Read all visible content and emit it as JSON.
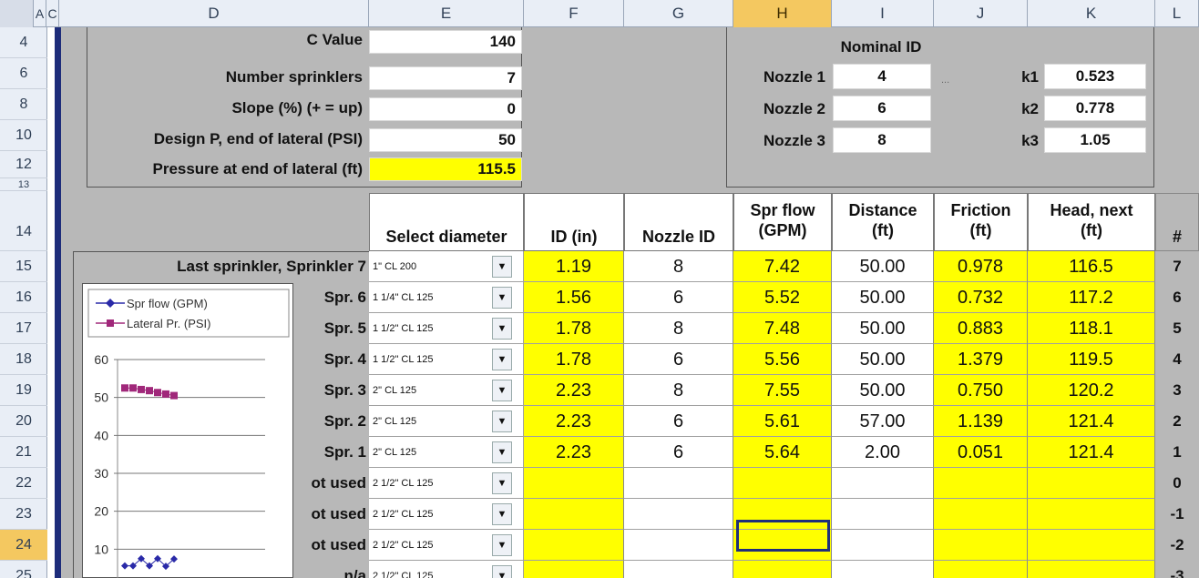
{
  "columns": [
    "A",
    "C",
    "D",
    "E",
    "F",
    "G",
    "H",
    "I",
    "J",
    "K",
    "L"
  ],
  "rows": [
    "4",
    "6",
    "8",
    "10",
    "12",
    "13",
    "14",
    "15",
    "16",
    "17",
    "18",
    "19",
    "20",
    "21",
    "22",
    "23",
    "24",
    "25"
  ],
  "inputs_panel": {
    "c_value_label": "C Value",
    "c_value": "140",
    "num_sprinklers_label": "Number sprinklers",
    "num_sprinklers": "7",
    "slope_label": "Slope (%) (+ = up)",
    "slope": "0",
    "design_p_label": "Design P, end of lateral (PSI)",
    "design_p": "50",
    "pressure_end_label": "Pressure at end of lateral (ft)",
    "pressure_end": "115.5"
  },
  "nozzle_panel": {
    "title": "Nominal ID",
    "nozzles": [
      {
        "label": "Nozzle 1",
        "id": "4",
        "k_label": "k1",
        "k": "0.523"
      },
      {
        "label": "Nozzle 2",
        "id": "6",
        "k_label": "k2",
        "k": "0.778"
      },
      {
        "label": "Nozzle 3",
        "id": "8",
        "k_label": "k3",
        "k": "1.05"
      }
    ],
    "ellipsis": "..."
  },
  "table": {
    "headers": {
      "select_diameter": "Select diameter",
      "id_in": "ID (in)",
      "nozzle_id": "Nozzle ID",
      "spr_flow_1": "Spr flow",
      "spr_flow_2": "(GPM)",
      "distance_1": "Distance",
      "distance_2": "(ft)",
      "friction_1": "Friction",
      "friction_2": "(ft)",
      "head_1": "Head, next",
      "head_2": "(ft)",
      "num": "#"
    },
    "rows": [
      {
        "label": "Last sprinkler, Sprinkler 7",
        "diameter": "1\" CL 200",
        "id_in": "1.19",
        "nozzle": "8",
        "flow": "7.42",
        "distance": "50.00",
        "friction": "0.978",
        "head": "116.5",
        "num": "7"
      },
      {
        "label": "Spr. 6",
        "diameter": "1 1/4\" CL 125",
        "id_in": "1.56",
        "nozzle": "6",
        "flow": "5.52",
        "distance": "50.00",
        "friction": "0.732",
        "head": "117.2",
        "num": "6"
      },
      {
        "label": "Spr. 5",
        "diameter": "1 1/2\" CL 125",
        "id_in": "1.78",
        "nozzle": "8",
        "flow": "7.48",
        "distance": "50.00",
        "friction": "0.883",
        "head": "118.1",
        "num": "5"
      },
      {
        "label": "Spr. 4",
        "diameter": "1 1/2\" CL 125",
        "id_in": "1.78",
        "nozzle": "6",
        "flow": "5.56",
        "distance": "50.00",
        "friction": "1.379",
        "head": "119.5",
        "num": "4"
      },
      {
        "label": "Spr. 3",
        "diameter": "2\" CL 125",
        "id_in": "2.23",
        "nozzle": "8",
        "flow": "7.55",
        "distance": "50.00",
        "friction": "0.750",
        "head": "120.2",
        "num": "3"
      },
      {
        "label": "Spr. 2",
        "diameter": "2\" CL 125",
        "id_in": "2.23",
        "nozzle": "6",
        "flow": "5.61",
        "distance": "57.00",
        "friction": "1.139",
        "head": "121.4",
        "num": "2"
      },
      {
        "label": "Spr. 1",
        "diameter": "2\" CL 125",
        "id_in": "2.23",
        "nozzle": "6",
        "flow": "5.64",
        "distance": "2.00",
        "friction": "0.051",
        "head": "121.4",
        "num": "1"
      },
      {
        "label": "ot used",
        "diameter": "2 1/2\" CL 125",
        "id_in": "",
        "nozzle": "",
        "flow": "",
        "distance": "",
        "friction": "",
        "head": "",
        "num": "0"
      },
      {
        "label": "ot used",
        "diameter": "2 1/2\" CL 125",
        "id_in": "",
        "nozzle": "",
        "flow": "",
        "distance": "",
        "friction": "",
        "head": "",
        "num": "-1"
      },
      {
        "label": "ot used",
        "diameter": "2 1/2\" CL 125",
        "id_in": "",
        "nozzle": "",
        "flow": "",
        "distance": "",
        "friction": "",
        "head": "",
        "num": "-2"
      },
      {
        "label": "n/a",
        "diameter": "2 1/2\" CL 125",
        "id_in": "",
        "nozzle": "",
        "flow": "",
        "distance": "",
        "friction": "",
        "head": "",
        "num": "-3"
      }
    ],
    "dropdown_glyph": "▼"
  },
  "chart_data": {
    "type": "scatter",
    "series": [
      {
        "name": "Spr flow (GPM)",
        "color": "#2a2aa8",
        "marker": "diamond",
        "x": [
          1,
          2,
          3,
          4,
          5,
          6,
          7
        ],
        "values": [
          5.6,
          5.6,
          7.5,
          5.6,
          7.5,
          5.5,
          7.4
        ]
      },
      {
        "name": "Lateral Pr. (PSI)",
        "color": "#a0287a",
        "marker": "square",
        "x": [
          1,
          2,
          3,
          4,
          5,
          6,
          7
        ],
        "values": [
          52.5,
          52.5,
          52.1,
          51.8,
          51.3,
          50.9,
          50.5
        ]
      }
    ],
    "yticks": [
      "60",
      "50",
      "40",
      "30",
      "20",
      "10",
      "0"
    ],
    "ylim": [
      0,
      60
    ]
  }
}
